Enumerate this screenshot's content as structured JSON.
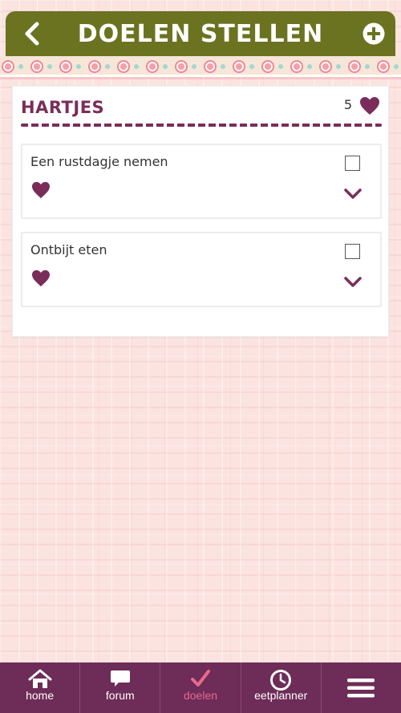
{
  "header": {
    "title": "DOELEN STELLEN",
    "back_icon": "chevron-left-icon",
    "add_icon": "plus-circle-icon"
  },
  "section": {
    "title": "HARTJES",
    "heart_count": "5",
    "heart_icon": "heart-icon"
  },
  "goals": [
    {
      "label": "Een rustdagje nemen",
      "checked": false
    },
    {
      "label": "Ontbijt eten",
      "checked": false
    }
  ],
  "nav": {
    "items": [
      {
        "label": "home",
        "icon": "home-icon"
      },
      {
        "label": "forum",
        "icon": "chat-bubble-icon"
      },
      {
        "label": "doelen",
        "icon": "checkmark-icon",
        "active": true
      },
      {
        "label": "eetplanner",
        "icon": "clock-icon"
      },
      {
        "label": "",
        "icon": "hamburger-menu-icon"
      }
    ]
  },
  "colors": {
    "header_green": "#6b7321",
    "accent_plum": "#7a2d5a",
    "nav_plum": "#6e2c58",
    "nav_active": "#e76a8c",
    "background_pink": "#fbe3e0"
  }
}
